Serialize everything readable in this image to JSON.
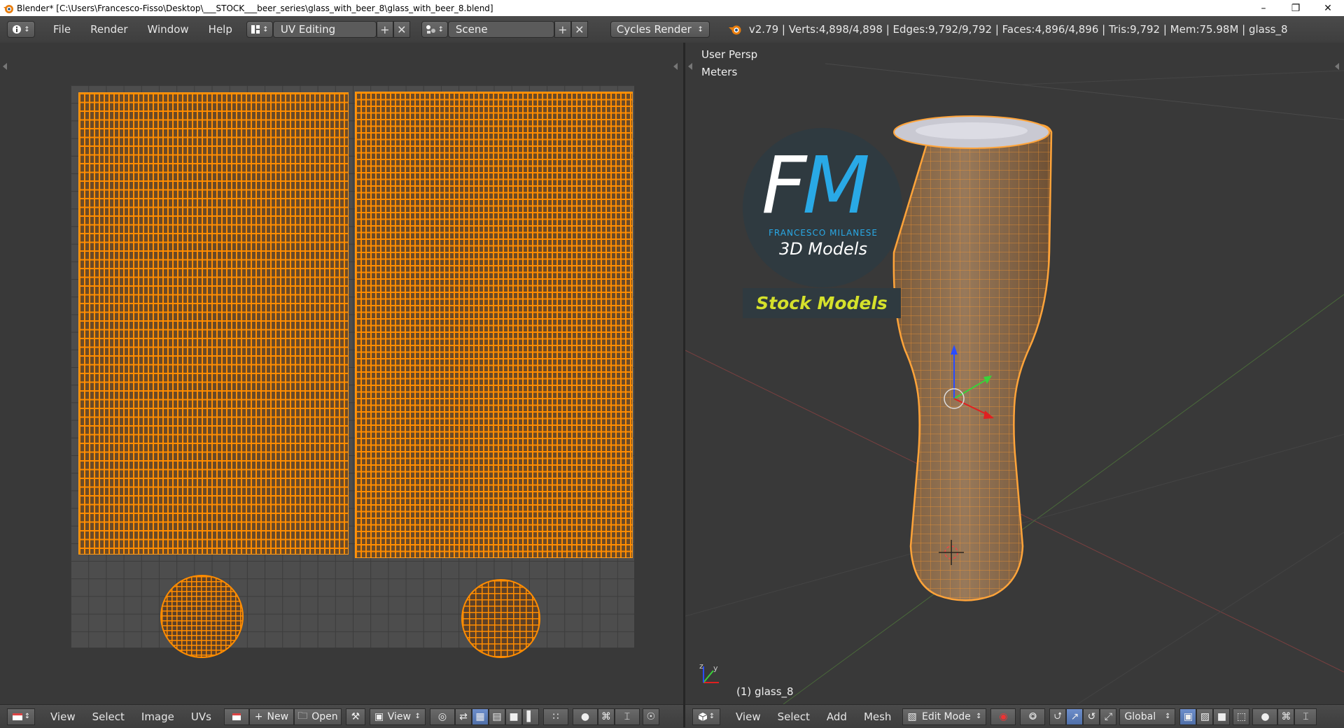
{
  "window": {
    "title": "Blender* [C:\\Users\\Francesco-Fisso\\Desktop\\___STOCK___beer_series\\glass_with_beer_8\\glass_with_beer_8.blend]",
    "minimize": "–",
    "maximize": "❐",
    "close": "✕"
  },
  "topbar": {
    "menus": [
      "File",
      "Render",
      "Window",
      "Help"
    ],
    "screen_layout": "UV Editing",
    "scene": "Scene",
    "render_engine": "Cycles Render",
    "stats": "v2.79 | Verts:4,898/4,898 | Edges:9,792/9,792 | Faces:4,896/4,896 | Tris:9,792 | Mem:75.98M | glass_8"
  },
  "viewport": {
    "view_name": "User Persp",
    "units": "Meters",
    "object_label": "(1) glass_8"
  },
  "logo": {
    "letter_f": "F",
    "letter_m": "M",
    "name": "FRANCESCO MILANESE",
    "subtitle": "3D Models",
    "banner": "Stock Models",
    "colors": {
      "blue": "#29a9e6",
      "yellow": "#d5e12b",
      "bg": "#2f3a40"
    }
  },
  "uv_bottombar": {
    "menus": [
      "View",
      "Select",
      "Image",
      "UVs"
    ],
    "new_label": "New",
    "open_label": "Open",
    "view_label": "View"
  },
  "viewport_bottombar": {
    "menus": [
      "View",
      "Select",
      "Add",
      "Mesh"
    ],
    "mode": "Edit Mode",
    "orientation": "Global"
  },
  "colors": {
    "background": "#393939",
    "selection_orange": "#ff8c00",
    "header": "#444444"
  }
}
